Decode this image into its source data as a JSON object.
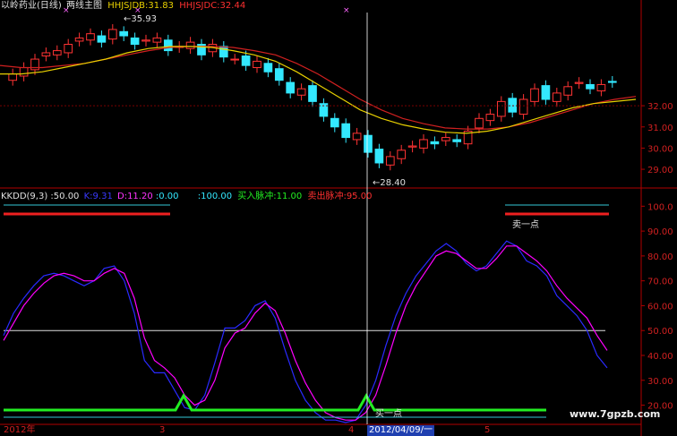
{
  "header": {
    "stock_name": "以岭药业(日线)",
    "main_label": "两线主图",
    "line1_label": "HHJSJDB:31.83",
    "line2_label": "HHJSJDC:32.44"
  },
  "sub_header": {
    "indicator": "KKDD(9,3)",
    "v50": ":50.00",
    "k_label": "K:9.31",
    "d_label": "D:11.20",
    "v0": ":0.00",
    "v100": ":100.00",
    "buy_pulse": "买入脉冲:11.00",
    "sell_pulse": "卖出脉冲:95.00"
  },
  "annotations": {
    "high_marker": "35.93",
    "low_marker": "28.40",
    "sell_point": "卖一点",
    "buy_point": "买一点",
    "cursor_date": "2012/04/09/一",
    "watermark": "www.7gpzb.com"
  },
  "colors": {
    "up_candle": "#ff3333",
    "down_candle": "#33e8ff",
    "line_yellow": "#e8d000",
    "line_red": "#d02020",
    "k_line": "#2a2aff",
    "d_line": "#ff00ff",
    "pulse": "#22ee22",
    "axis_red": "#b00000"
  },
  "chart_data": [
    {
      "type": "candlestick",
      "title": "两线主图",
      "y_ticks": [
        "32.00",
        "31.00",
        "30.00",
        "29.00"
      ],
      "ylim": [
        28.2,
        36.4
      ],
      "series": [
        {
          "name": "HHJSJDB",
          "values": [
            33.5,
            33.5,
            33.6,
            33.8,
            34.0,
            34.2,
            34.5,
            34.7,
            34.8,
            34.8,
            34.75,
            34.6,
            34.4,
            34.1,
            33.6,
            33.0,
            32.4,
            31.8,
            31.4,
            31.1,
            30.9,
            30.75,
            30.7,
            30.8,
            31.0,
            31.3,
            31.6,
            31.9,
            32.1,
            32.2,
            32.3
          ]
        },
        {
          "name": "HHJSJDC",
          "values": [
            33.9,
            33.8,
            33.8,
            33.9,
            34.0,
            34.2,
            34.4,
            34.6,
            34.75,
            34.8,
            34.8,
            34.75,
            34.6,
            34.4,
            34.0,
            33.5,
            32.9,
            32.3,
            31.8,
            31.4,
            31.15,
            30.95,
            30.9,
            30.9,
            31.0,
            31.2,
            31.5,
            31.8,
            32.1,
            32.3,
            32.44
          ]
        }
      ],
      "x_labels": [
        "2012年",
        "3",
        "4",
        "5"
      ]
    },
    {
      "type": "line",
      "title": "KKDD(9,3)",
      "y_ticks": [
        "100.0",
        "90.00",
        "80.00",
        "70.00",
        "60.00",
        "50.00",
        "40.00",
        "30.00",
        "20.00"
      ],
      "ylim": [
        13,
        103
      ],
      "series": [
        {
          "name": "K",
          "values": [
            48,
            57,
            63,
            68,
            72,
            73,
            72,
            70,
            68,
            70,
            75,
            76,
            70,
            57,
            38,
            33,
            33,
            26,
            19,
            18,
            24,
            37,
            51,
            51,
            54,
            60,
            62,
            55,
            42,
            30,
            22,
            17,
            14,
            14,
            13,
            14,
            20,
            30,
            44,
            56,
            65,
            72,
            77,
            82,
            85,
            82,
            77,
            74,
            76,
            81,
            86,
            84,
            78,
            76,
            72,
            64,
            60,
            56,
            50,
            40,
            35
          ]
        },
        {
          "name": "D",
          "values": [
            46,
            53,
            60,
            65,
            69,
            72,
            73,
            72,
            70,
            70,
            73,
            75,
            73,
            63,
            47,
            38,
            35,
            31,
            24,
            20,
            22,
            30,
            43,
            49,
            51,
            57,
            61,
            58,
            49,
            38,
            29,
            22,
            17,
            15,
            14,
            14,
            17,
            24,
            36,
            49,
            60,
            68,
            74,
            80,
            82,
            81,
            78,
            75,
            75,
            79,
            84,
            84,
            81,
            78,
            74,
            68,
            63,
            59,
            55,
            48,
            42
          ]
        }
      ]
    }
  ]
}
